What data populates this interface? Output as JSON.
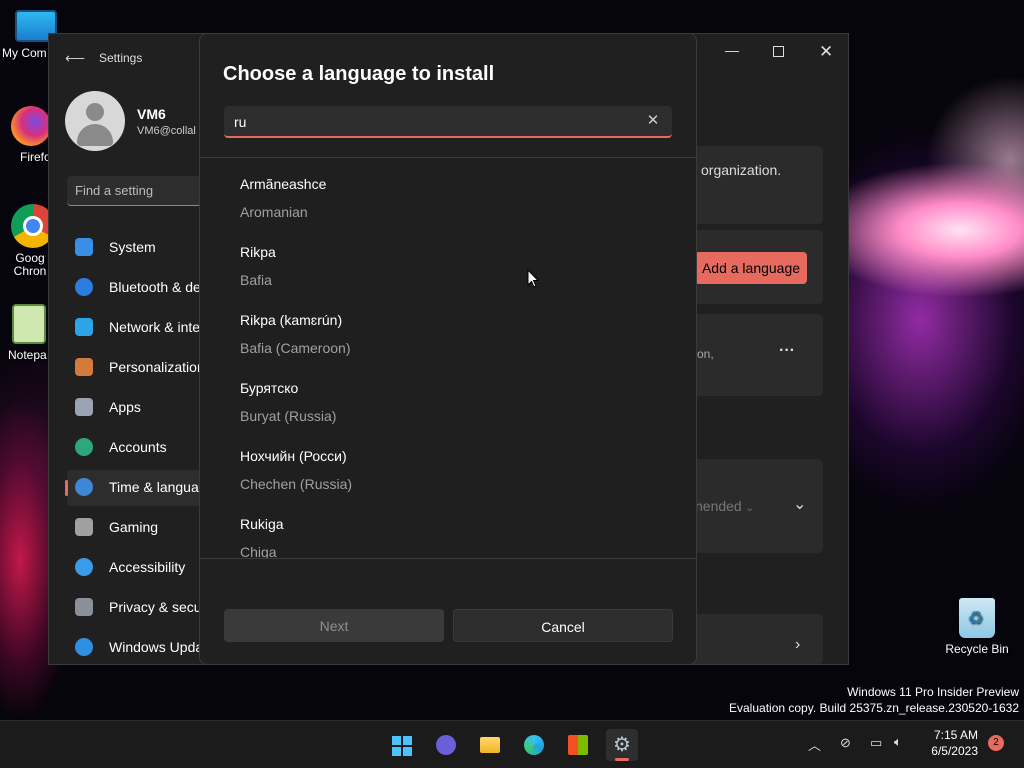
{
  "desktop": {
    "icons": [
      {
        "label": "My Com"
      },
      {
        "label": "Firefo"
      },
      {
        "label": "Goog Chron"
      },
      {
        "label": "Notepa"
      }
    ],
    "recycle_bin": "Recycle Bin",
    "watermark_line1": "Windows 11 Pro Insider Preview",
    "watermark_line2": "Evaluation copy. Build 25375.zn_release.230520-1632"
  },
  "settings": {
    "app_title": "Settings",
    "user_name": "VM6",
    "user_email": "VM6@collal",
    "search_placeholder": "Find a setting",
    "nav": [
      {
        "label": "System",
        "icon": "monitor-icon",
        "color": "#3a8ee6"
      },
      {
        "label": "Bluetooth & de",
        "icon": "bluetooth-icon",
        "color": "#2b7de0"
      },
      {
        "label": "Network & inte",
        "icon": "wifi-icon",
        "color": "#2fa3e8"
      },
      {
        "label": "Personalization",
        "icon": "brush-icon",
        "color": "#d47a3a"
      },
      {
        "label": "Apps",
        "icon": "apps-icon",
        "color": "#9aa3b2"
      },
      {
        "label": "Accounts",
        "icon": "person-icon",
        "color": "#2ea87a"
      },
      {
        "label": "Time & langua",
        "icon": "globe-clock-icon",
        "color": "#3e87d6"
      },
      {
        "label": "Gaming",
        "icon": "gamepad-icon",
        "color": "#a0a0a0"
      },
      {
        "label": "Accessibility",
        "icon": "accessibility-icon",
        "color": "#3a9ce8"
      },
      {
        "label": "Privacy & secu",
        "icon": "shield-icon",
        "color": "#8a8f99"
      },
      {
        "label": "Windows Upda",
        "icon": "update-icon",
        "color": "#2f8fe0"
      }
    ],
    "selected_nav_index": 6,
    "bg_text_org": "organization.",
    "bg_add_language": "Add a language",
    "bg_text_on": "on,",
    "bg_recommended": "nended"
  },
  "dialog": {
    "title": "Choose a language to install",
    "search_value": "ru",
    "languages": [
      {
        "name": "Armãneashce",
        "english": "Aromanian"
      },
      {
        "name": "Rikpa",
        "english": "Bafia"
      },
      {
        "name": "Rikpa (kamɛrún)",
        "english": "Bafia (Cameroon)"
      },
      {
        "name": "Бурятско",
        "english": "Buryat (Russia)"
      },
      {
        "name": "Нохчийн (Росси)",
        "english": "Chechen (Russia)"
      },
      {
        "name": "Rukiga",
        "english": "Chiga"
      }
    ],
    "next_label": "Next",
    "cancel_label": "Cancel"
  },
  "taskbar": {
    "time": "7:15 AM",
    "date": "6/5/2023",
    "notification_count": "2"
  },
  "colors": {
    "accent": "#e76a5f",
    "window_bg": "#202020"
  }
}
